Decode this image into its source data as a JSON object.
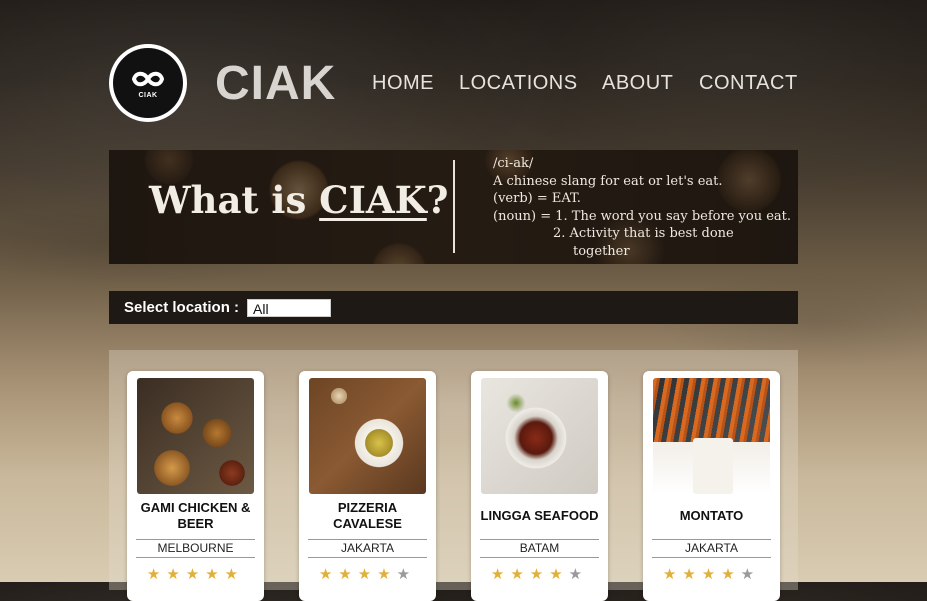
{
  "header": {
    "logo_text": "CIAK",
    "brand": "CIAK",
    "nav": {
      "home": "HOME",
      "locations": "LOCATIONS",
      "about": "ABOUT",
      "contact": "CONTACT"
    }
  },
  "banner": {
    "title_prefix": "What is ",
    "title_word": "CIAK",
    "title_suffix": "?",
    "definition": {
      "pron": "/ci-ak/",
      "line1": "A chinese slang for eat or let's eat.",
      "verb": "(verb) =   EAT.",
      "noun": "(noun) =   1. The word you say before you eat.",
      "noun2": "2. Activity that is best done",
      "noun3": "together"
    }
  },
  "filter": {
    "label": "Select location :",
    "selected": "All"
  },
  "restaurants": [
    {
      "name": "GAMI CHICKEN & BEER",
      "location": "MELBOURNE",
      "rating": 5,
      "image_icon": "fried-chicken-photo"
    },
    {
      "name": "PIZZERIA CAVALESE",
      "location": "JAKARTA",
      "rating": 4,
      "image_icon": "pasta-photo"
    },
    {
      "name": "LINGGA SEAFOOD",
      "location": "BATAM",
      "rating": 4,
      "image_icon": "crab-photo"
    },
    {
      "name": "MONTATO",
      "location": "JAKARTA",
      "rating": 4,
      "image_icon": "fries-photo"
    }
  ],
  "colors": {
    "star_on": "#e0b13a",
    "star_off": "#9a9a9a",
    "select_bar": "#1e1915"
  }
}
